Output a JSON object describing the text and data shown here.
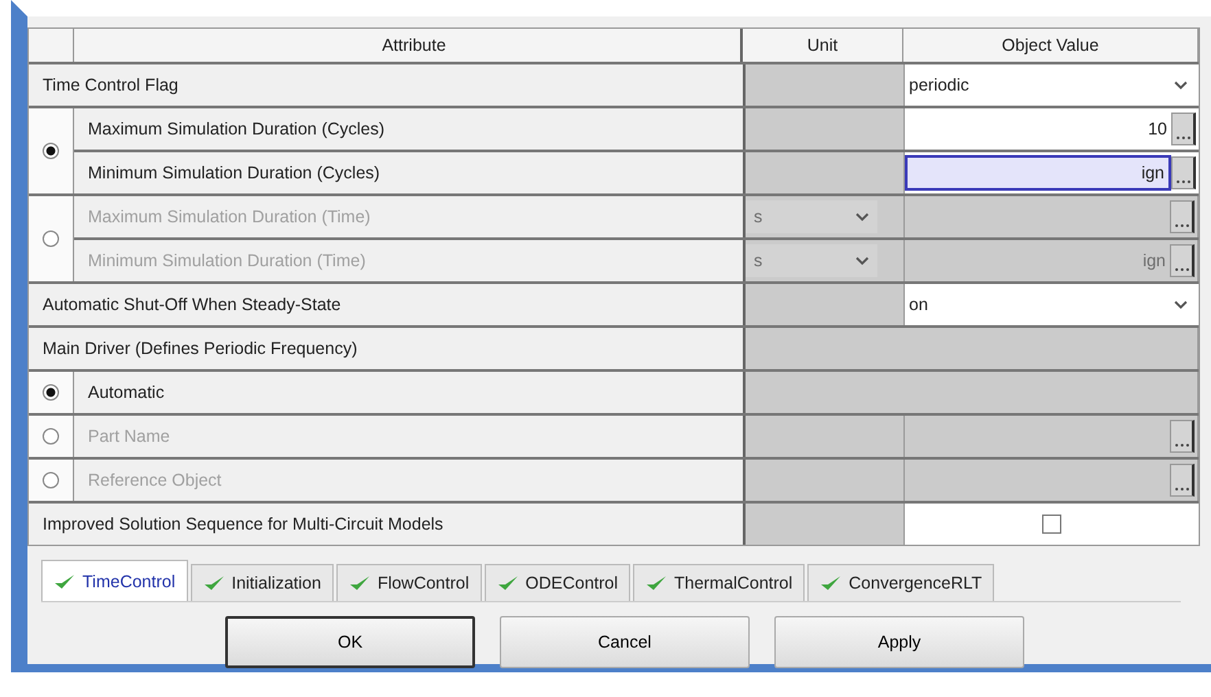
{
  "table": {
    "columns": [
      "Attribute",
      "Unit",
      "Object Value"
    ],
    "rows": [
      {
        "kind": "field",
        "label": "Time Control Flag",
        "disabled": false,
        "value": {
          "kind": "dropdown",
          "text": "periodic"
        }
      },
      {
        "kind": "radio",
        "selected": true,
        "children": [
          {
            "label": "Maximum Simulation Duration (Cycles)",
            "disabled": false,
            "value": {
              "kind": "text",
              "text": "10",
              "browse": true,
              "focused": false
            }
          },
          {
            "label": "Minimum Simulation Duration (Cycles)",
            "disabled": false,
            "value": {
              "kind": "text",
              "text": "ign",
              "browse": true,
              "focused": true
            }
          }
        ]
      },
      {
        "kind": "radio",
        "selected": false,
        "children": [
          {
            "label": "Maximum Simulation Duration (Time)",
            "disabled": true,
            "unit": {
              "text": "s"
            },
            "value": {
              "kind": "text",
              "browse": true,
              "focused": false
            }
          },
          {
            "label": "Minimum Simulation Duration (Time)",
            "disabled": true,
            "unit": {
              "text": "s"
            },
            "value": {
              "kind": "text",
              "text": "ign",
              "browse": true,
              "focused": false
            }
          }
        ]
      },
      {
        "kind": "field",
        "label": "Automatic Shut-Off When Steady-State",
        "disabled": false,
        "value": {
          "kind": "dropdown",
          "text": "on"
        }
      },
      {
        "kind": "field",
        "label": "Main Driver (Defines Periodic Frequency)",
        "disabled": false
      },
      {
        "kind": "radio",
        "selected": true,
        "children": [
          {
            "label": "Automatic",
            "disabled": false
          }
        ]
      },
      {
        "kind": "radio",
        "selected": false,
        "children": [
          {
            "label": "Part Name",
            "disabled": true,
            "value": {
              "kind": "text",
              "browse": true,
              "focused": false
            }
          }
        ]
      },
      {
        "kind": "radio",
        "selected": false,
        "children": [
          {
            "label": "Reference Object",
            "disabled": true,
            "value": {
              "kind": "text",
              "browse": true,
              "focused": false
            }
          }
        ]
      },
      {
        "kind": "field",
        "label": "Improved Solution Sequence for Multi-Circuit Models",
        "disabled": false,
        "value": {
          "kind": "checkbox",
          "checked": false
        }
      }
    ]
  },
  "tabs": [
    {
      "label": "TimeControl",
      "selected": true
    },
    {
      "label": "Initialization",
      "selected": false
    },
    {
      "label": "FlowControl",
      "selected": false
    },
    {
      "label": "ODEControl",
      "selected": false
    },
    {
      "label": "ThermalControl",
      "selected": false
    },
    {
      "label": "ConvergenceRLT",
      "selected": false
    }
  ],
  "buttons": [
    {
      "label": "OK",
      "default": true
    },
    {
      "label": "Cancel",
      "default": false
    },
    {
      "label": "Apply",
      "default": false
    }
  ]
}
